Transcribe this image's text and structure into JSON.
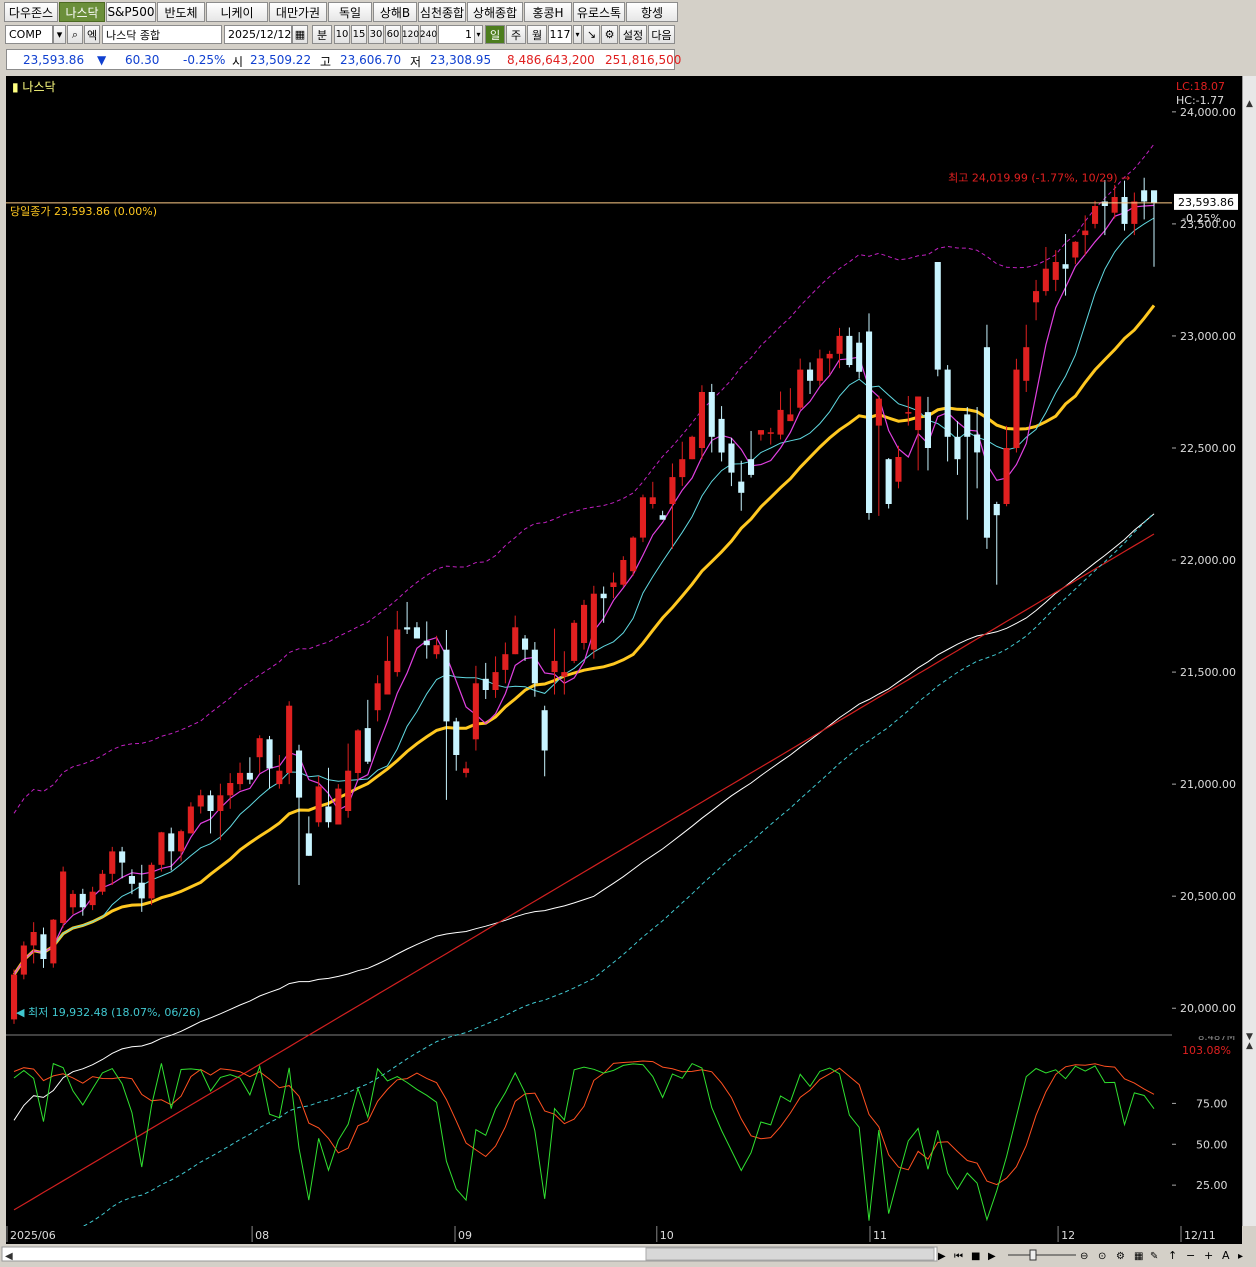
{
  "market_tabs": [
    "다우존스",
    "나스닥",
    "S&P500",
    "반도체",
    "니케이",
    "대만가권",
    "독일",
    "상해B",
    "심천종합",
    "상해종합",
    "홍콩H",
    "유로스톡",
    "항셍"
  ],
  "active_tab": "나스닥",
  "toolbar": {
    "symbol_code": "COMP",
    "symbol_name": "나스닥 종합",
    "date": "2025/12/12",
    "period_min_label": "분",
    "intervals": [
      "10",
      "15",
      "30",
      "60",
      "120",
      "240"
    ],
    "interval_value": "1",
    "day_label": "일",
    "week_label": "주",
    "month_label": "월",
    "bar_count": "117",
    "settings_label": "설정",
    "next_label": "다음",
    "code_label": "엑"
  },
  "quote": {
    "last": "23,593.86",
    "change_arrow": "▼",
    "change": "60.30",
    "change_pct": "-0.25%",
    "open_label": "시",
    "open": "23,509.22",
    "high_label": "고",
    "high": "23,606.70",
    "low_label": "저",
    "low": "23,308.95",
    "volume": "8,486,643,200",
    "amount": "251,816,500"
  },
  "chart": {
    "title": "나스닥",
    "current_line_label": "당일종가 23,593.86 (0.00%)",
    "high_annotation": "최고 24,019.99 (-1.77%, 10/29)",
    "low_annotation": "최저 19,932.48 (18.07%, 06/26)",
    "lc_label": "LC:18.07",
    "hc_label": "HC:-1.77",
    "price_box": "23,593.86",
    "price_box_pct": "-0.25%",
    "osc_top_label": "8.487M",
    "osc_pct_label": "103.08%",
    "colors": {
      "up": "#e02020",
      "down": "#c8f4ff",
      "ma_fast": "#e040e0",
      "ma_mid": "#60d8e0",
      "ma_yellow": "#ffc820",
      "ma_white": "#ffffff",
      "ma_red": "#d02020",
      "band_upper": "#c020c0",
      "band_lower": "#40c8d0",
      "osc_red": "#ff5020",
      "osc_green": "#30e030"
    }
  },
  "chart_data": {
    "type": "candlestick",
    "y_ticks": [
      "24,000.00",
      "23,500.00",
      "23,000.00",
      "22,500.00",
      "22,000.00",
      "21,500.00",
      "21,000.00",
      "20,500.00",
      "20,000.00"
    ],
    "y_tick_values": [
      24000,
      23500,
      23000,
      22500,
      22000,
      21500,
      21000,
      20500,
      20000
    ],
    "ylim": [
      19885,
      24160
    ],
    "osc_ticks": [
      "75.00",
      "50.00",
      "25.00"
    ],
    "osc_tick_values": [
      75,
      50,
      25
    ],
    "x_labels": [
      "2025/06",
      "08",
      "09",
      "10",
      "11",
      "12",
      "12/11"
    ],
    "candles": [
      [
        19950,
        20150,
        19930,
        20173
      ],
      [
        20150,
        20280,
        20129,
        20298
      ],
      [
        20280,
        20340,
        20200,
        20384
      ],
      [
        20330,
        20220,
        20180,
        20360
      ],
      [
        20200,
        20395,
        20181,
        20398
      ],
      [
        20380,
        20610,
        20360,
        20632
      ],
      [
        20450,
        20510,
        20420,
        20527
      ],
      [
        20510,
        20450,
        20413,
        20533
      ],
      [
        20460,
        20520,
        20438,
        20542
      ],
      [
        20520,
        20600,
        20506,
        20617
      ],
      [
        20600,
        20700,
        20550,
        20720
      ],
      [
        20700,
        20650,
        20580,
        20720
      ],
      [
        20590,
        20555,
        20509,
        20620
      ],
      [
        20560,
        20490,
        20430,
        20640
      ],
      [
        20490,
        20640,
        20460,
        20650
      ],
      [
        20640,
        20785,
        20610,
        20787
      ],
      [
        20780,
        20700,
        20615,
        20806
      ],
      [
        20700,
        20790,
        20655,
        20797
      ],
      [
        20780,
        20900,
        20780,
        20919
      ],
      [
        20900,
        20950,
        20869,
        20975
      ],
      [
        20950,
        20880,
        20780,
        20972
      ],
      [
        20880,
        20950,
        20750,
        21002
      ],
      [
        20950,
        21005,
        20890,
        21049
      ],
      [
        21000,
        21050,
        20973,
        21096
      ],
      [
        21050,
        21020,
        21000,
        21120
      ],
      [
        21120,
        21205,
        21050,
        21218
      ],
      [
        21200,
        21070,
        20980,
        21215
      ],
      [
        21000,
        21060,
        20980,
        21130
      ],
      [
        21050,
        21350,
        21000,
        21370
      ],
      [
        21150,
        20940,
        20550,
        21176
      ],
      [
        20780,
        20680,
        20680,
        20856
      ],
      [
        20830,
        20990,
        20810,
        21037
      ],
      [
        20900,
        20830,
        20806,
        21073
      ],
      [
        20820,
        20980,
        20820,
        21000
      ],
      [
        20880,
        21060,
        20850,
        21181
      ],
      [
        21050,
        21240,
        21020,
        21245
      ],
      [
        21250,
        21100,
        21090,
        21376
      ],
      [
        21330,
        21450,
        21280,
        21486
      ],
      [
        21400,
        21550,
        21400,
        21660
      ],
      [
        21500,
        21690,
        21480,
        21773
      ],
      [
        21700,
        21690,
        21670,
        21813
      ],
      [
        21700,
        21650,
        21650,
        21723
      ],
      [
        21640,
        21620,
        21560,
        21726
      ],
      [
        21580,
        21620,
        21560,
        21662
      ],
      [
        21600,
        21280,
        20930,
        21688
      ],
      [
        21280,
        21130,
        21060,
        21296
      ],
      [
        21050,
        21070,
        21030,
        21100
      ],
      [
        21200,
        21450,
        21150,
        21528
      ],
      [
        21470,
        21420,
        21380,
        21541
      ],
      [
        21420,
        21500,
        21385,
        21570
      ],
      [
        21510,
        21580,
        21450,
        21632
      ],
      [
        21580,
        21700,
        21580,
        21752
      ],
      [
        21650,
        21600,
        21550,
        21665
      ],
      [
        21600,
        21450,
        21390,
        21634
      ],
      [
        21330,
        21150,
        21035,
        21350
      ],
      [
        21500,
        21550,
        21400,
        21694
      ],
      [
        21480,
        21500,
        21400,
        21593
      ],
      [
        21550,
        21720,
        21540,
        21732
      ],
      [
        21630,
        21800,
        21600,
        21822
      ],
      [
        21600,
        21850,
        21560,
        21885
      ],
      [
        21850,
        21830,
        21720,
        21882
      ],
      [
        21880,
        21900,
        21830,
        21944
      ],
      [
        21890,
        22000,
        21880,
        22017
      ],
      [
        21950,
        22100,
        21930,
        22106
      ],
      [
        22100,
        22280,
        22080,
        22292
      ],
      [
        22250,
        22280,
        22230,
        22349
      ],
      [
        22200,
        22180,
        22180,
        22220
      ],
      [
        22250,
        22370,
        22050,
        22431
      ],
      [
        22370,
        22450,
        22331,
        22528
      ],
      [
        22450,
        22550,
        22450,
        22555
      ],
      [
        22500,
        22750,
        22450,
        22780
      ],
      [
        22750,
        22550,
        22480,
        22786
      ],
      [
        22630,
        22480,
        22440,
        22687
      ],
      [
        22520,
        22390,
        22330,
        22545
      ],
      [
        22350,
        22300,
        22220,
        22443
      ],
      [
        22450,
        22380,
        22368,
        22576
      ],
      [
        22560,
        22580,
        22533,
        22567
      ],
      [
        22570,
        22570,
        22515,
        22590
      ],
      [
        22560,
        22670,
        22538,
        22752
      ],
      [
        22620,
        22650,
        22620,
        22767
      ],
      [
        22680,
        22850,
        22670,
        22899
      ],
      [
        22850,
        22800,
        22741,
        22882
      ],
      [
        22800,
        22900,
        22778,
        22939
      ],
      [
        22900,
        22920,
        22827,
        22934
      ],
      [
        22920,
        23000,
        22856,
        23036
      ],
      [
        23000,
        22870,
        22860,
        23038
      ],
      [
        22970,
        22840,
        22810,
        23017
      ],
      [
        23020,
        22210,
        22180,
        23101
      ],
      [
        22600,
        22720,
        22197,
        22733
      ],
      [
        22450,
        22250,
        22230,
        22455
      ],
      [
        22350,
        22460,
        22320,
        22510
      ],
      [
        22660,
        22660,
        22600,
        22732
      ],
      [
        22580,
        22730,
        22400,
        22729
      ],
      [
        22660,
        22500,
        22400,
        22728
      ],
      [
        22670,
        22760,
        22613,
        22774
      ],
      [
        23000,
        22850,
        22800,
        23063
      ],
      [
        22990,
        22930,
        22920,
        23006
      ],
      [
        22800,
        22860,
        22545,
        22991
      ],
      [
        22700,
        22950,
        22650,
        23000
      ],
      [
        23200,
        23250,
        23120,
        23263
      ],
      [
        23300,
        23500,
        23300,
        23554
      ],
      [
        23650,
        23750,
        23620,
        23800
      ],
      [
        23850,
        24000,
        23840,
        24022
      ],
      [
        23650,
        23550,
        23550,
        23800
      ],
      [
        23800,
        23950,
        23500,
        23957
      ],
      [
        23700,
        23900,
        23702,
        23960
      ],
      [
        23950,
        23820,
        23810,
        24006
      ],
      [
        23500,
        23400,
        23350,
        23525
      ],
      [
        23530,
        23400,
        23350,
        23550
      ],
      [
        23420,
        23180,
        23080,
        23452
      ],
      [
        23250,
        23170,
        23130,
        23267
      ],
      [
        22950,
        23000,
        22620,
        23072
      ],
      [
        23450,
        23400,
        23360,
        23537
      ],
      [
        23420,
        23300,
        23220,
        23540
      ],
      [
        23400,
        23500,
        23330,
        23540
      ],
      [
        23400,
        23450,
        23380,
        23554
      ],
      [
        23550,
        23350,
        23350,
        23563
      ]
    ],
    "tail_candles": [
      [
        23330,
        22850,
        22820,
        23324
      ],
      [
        22850,
        22550,
        22440,
        22870
      ],
      [
        22550,
        22450,
        22380,
        22620
      ],
      [
        22650,
        22550,
        22180,
        22683
      ],
      [
        22560,
        22480,
        22320,
        22683
      ],
      [
        22950,
        22100,
        22050,
        23050
      ],
      [
        22250,
        22200,
        21890,
        22260
      ],
      [
        22250,
        22500,
        22240,
        22599
      ],
      [
        22500,
        22850,
        22480,
        22898
      ],
      [
        22800,
        22950,
        22750,
        23050
      ],
      [
        23150,
        23200,
        23070,
        23250
      ],
      [
        23200,
        23300,
        23180,
        23397
      ],
      [
        23250,
        23330,
        23200,
        23383
      ],
      [
        23320,
        23300,
        23180,
        23455
      ],
      [
        23350,
        23420,
        23320,
        23423
      ],
      [
        23450,
        23470,
        23360,
        23538
      ],
      [
        23500,
        23580,
        23480,
        23603
      ],
      [
        23600,
        23580,
        23450,
        23696
      ],
      [
        23550,
        23620,
        23524,
        23674
      ],
      [
        23620,
        23500,
        23470,
        23693
      ],
      [
        23500,
        23600,
        23450,
        23640
      ],
      [
        23650,
        23600,
        23520,
        23706
      ],
      [
        23650,
        23593.86,
        23308.95,
        23606.7
      ]
    ]
  }
}
